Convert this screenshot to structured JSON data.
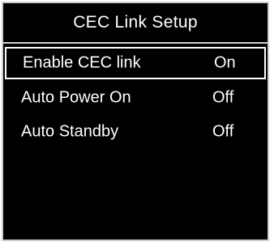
{
  "menu": {
    "title": "CEC  Link Setup",
    "items": [
      {
        "label": "Enable CEC link",
        "value": "On",
        "selected": true
      },
      {
        "label": "Auto Power On",
        "value": "Off",
        "selected": false
      },
      {
        "label": "Auto Standby",
        "value": "Off",
        "selected": false
      }
    ]
  },
  "colors": {
    "background": "#000000",
    "text": "#ffffff",
    "border": "#cfcfcf",
    "highlight": "#ffffff"
  }
}
